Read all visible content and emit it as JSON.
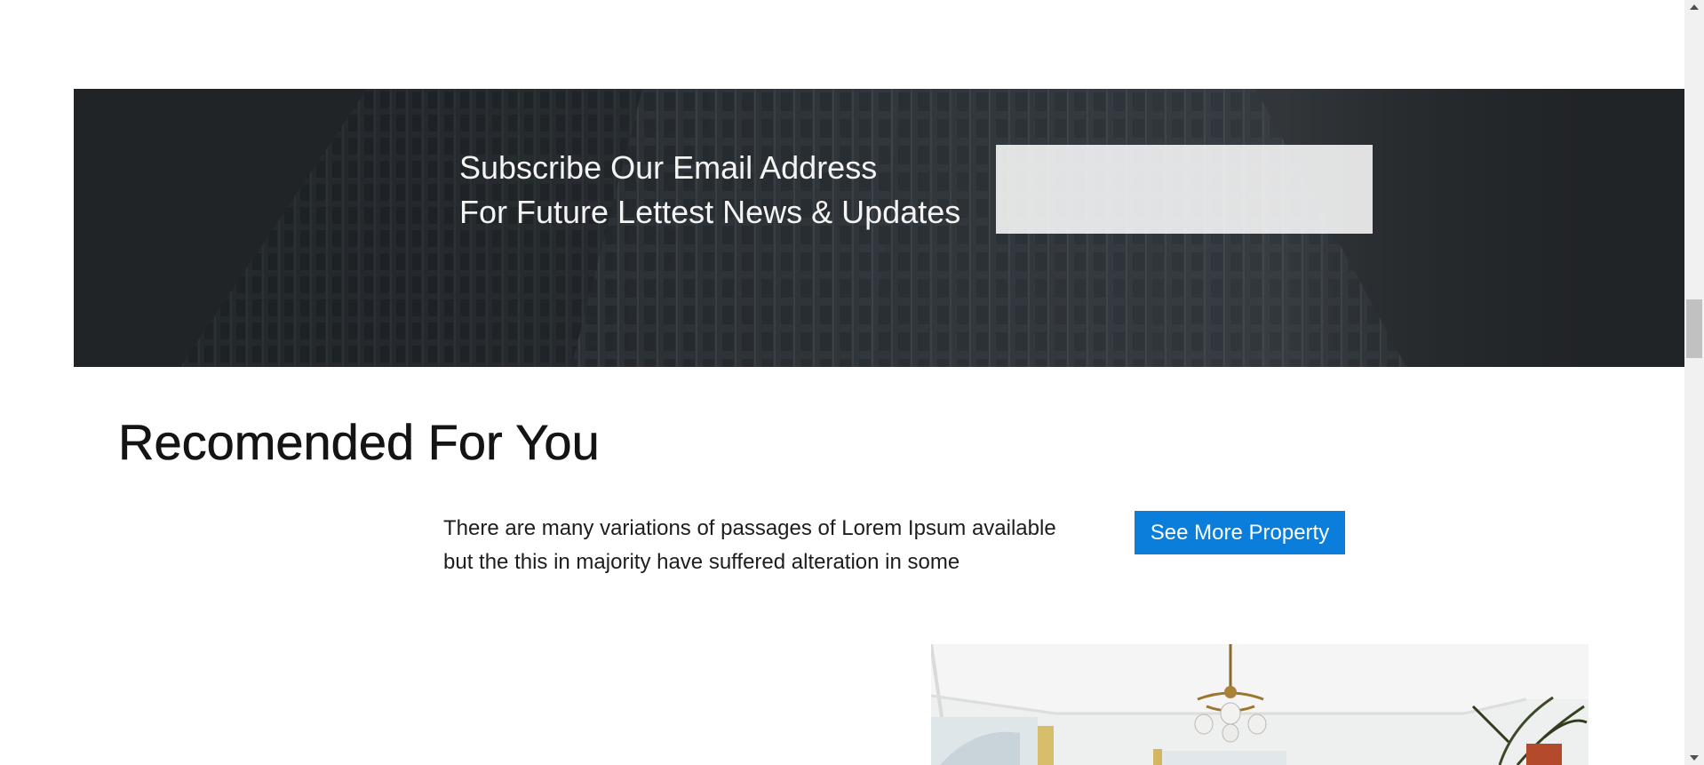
{
  "subscribe": {
    "heading_line1": "Subscribe Our Email Address",
    "heading_line2": "For Future Lettest News & Updates",
    "email_placeholder": ""
  },
  "recommended": {
    "title": "Recomended For You",
    "description_line1": "There are many variations of passages of Lorem Ipsum available",
    "description_line2": "but the this in majority have suffered alteration in some",
    "see_more_label": "See More Property"
  },
  "colors": {
    "banner_overlay": "#25292d",
    "button_bg": "#0b7ddb",
    "button_text": "#ffffff",
    "title_text": "#141414"
  },
  "icons": {
    "scroll_up": "scroll-up-arrow-icon",
    "scroll_down": "scroll-down-arrow-icon"
  }
}
